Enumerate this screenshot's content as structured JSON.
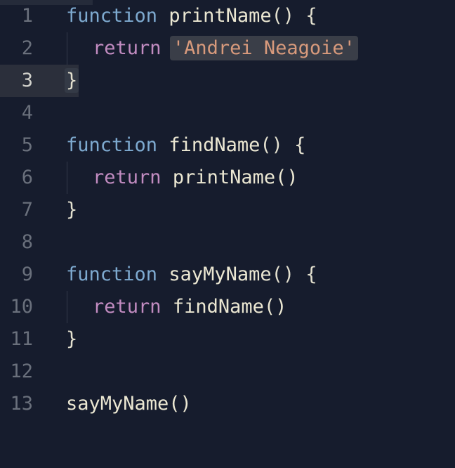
{
  "editor": {
    "lines": [
      {
        "number": "1",
        "keyword": "function",
        "name": "printName",
        "tail": "() {"
      },
      {
        "number": "2",
        "keyword": "return",
        "value": "'Andrei Neagoie'"
      },
      {
        "number": "3",
        "text": "}"
      },
      {
        "number": "4",
        "text": ""
      },
      {
        "number": "5",
        "keyword": "function",
        "name": "findName",
        "tail": "() {"
      },
      {
        "number": "6",
        "keyword": "return",
        "value": "printName()"
      },
      {
        "number": "7",
        "text": "}"
      },
      {
        "number": "8",
        "text": ""
      },
      {
        "number": "9",
        "keyword": "function",
        "name": "sayMyName",
        "tail": "() {"
      },
      {
        "number": "10",
        "keyword": "return",
        "value": "findName()"
      },
      {
        "number": "11",
        "text": "}"
      },
      {
        "number": "12",
        "text": ""
      },
      {
        "number": "13",
        "text": "sayMyName()"
      }
    ],
    "active_line": "3",
    "colors": {
      "background": "#161c2d",
      "keyword": "#7eaad0",
      "return_keyword": "#c28cc1",
      "string": "#d89a7c",
      "identifier": "#ebe7d2",
      "line_number": "#6a707c"
    }
  }
}
